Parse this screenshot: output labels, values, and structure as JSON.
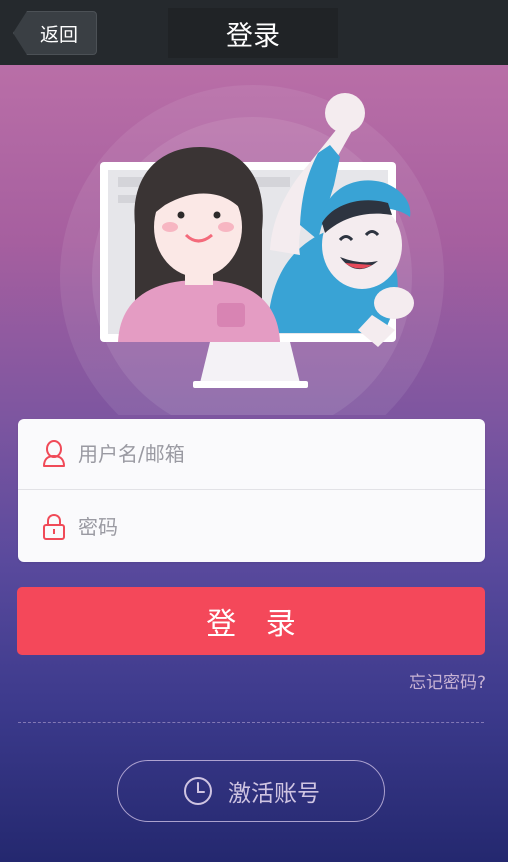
{
  "navbar": {
    "back_label": "返回",
    "title": "登录"
  },
  "form": {
    "username_placeholder": "用户名/邮箱",
    "password_placeholder": "密码",
    "username_icon": "user-icon",
    "password_icon": "lock-icon"
  },
  "login_button_label": "登 录",
  "forgot_password_label": "忘记密码?",
  "activate": {
    "label": "激活账号",
    "icon": "clock-icon"
  },
  "colors": {
    "navbar": "#25292d",
    "accent": "#f4485a",
    "icon_red": "#f04a58"
  }
}
